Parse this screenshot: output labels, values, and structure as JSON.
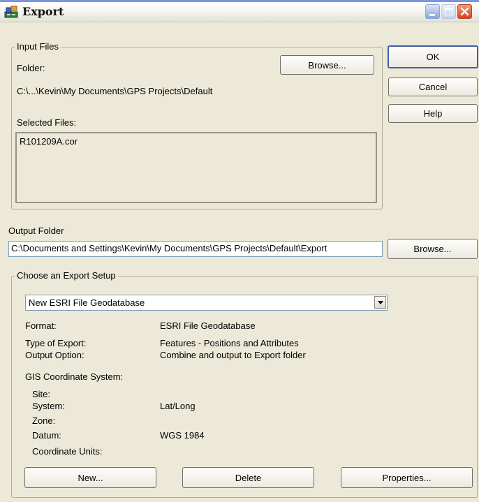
{
  "window": {
    "title": "Export"
  },
  "buttons": {
    "ok": "OK",
    "cancel": "Cancel",
    "help": "Help"
  },
  "input_files": {
    "group_label": "Input Files",
    "folder_label": "Folder:",
    "browse_label": "Browse...",
    "folder_path": "C:\\...\\Kevin\\My Documents\\GPS Projects\\Default",
    "selected_label": "Selected Files:",
    "selected_files": [
      "R101209A.cor"
    ]
  },
  "output": {
    "label": "Output Folder",
    "path": "C:\\Documents and Settings\\Kevin\\My Documents\\GPS Projects\\Default\\Export",
    "browse_label": "Browse..."
  },
  "setup": {
    "group_label": "Choose an Export Setup",
    "selected": "New ESRI File Geodatabase",
    "format_label": "Format:",
    "format_value": "ESRI File Geodatabase",
    "type_label": "Type of Export:",
    "type_value": "Features - Positions and Attributes",
    "option_label": "Output Option:",
    "option_value": "Combine and output to Export folder",
    "gis_label": "GIS Coordinate System:",
    "site_label": "Site:",
    "site_value": "",
    "system_label": "System:",
    "system_value": "Lat/Long",
    "zone_label": "Zone:",
    "zone_value": "",
    "datum_label": "Datum:",
    "datum_value": "WGS 1984",
    "units_label": "Coordinate Units:",
    "units_value": "",
    "new_label": "New...",
    "delete_label": "Delete",
    "properties_label": "Properties..."
  },
  "icons": {
    "app": "export-app-icon",
    "minimize": "minimize-icon",
    "maximize": "maximize-icon",
    "close": "close-icon",
    "dropdown": "chevron-down-icon"
  },
  "colors": {
    "titlebar": "#f4f4f0",
    "close_button": "#d5431e",
    "dialog_bg": "#ece9d8",
    "default_button_border": "#3f5ea8"
  }
}
